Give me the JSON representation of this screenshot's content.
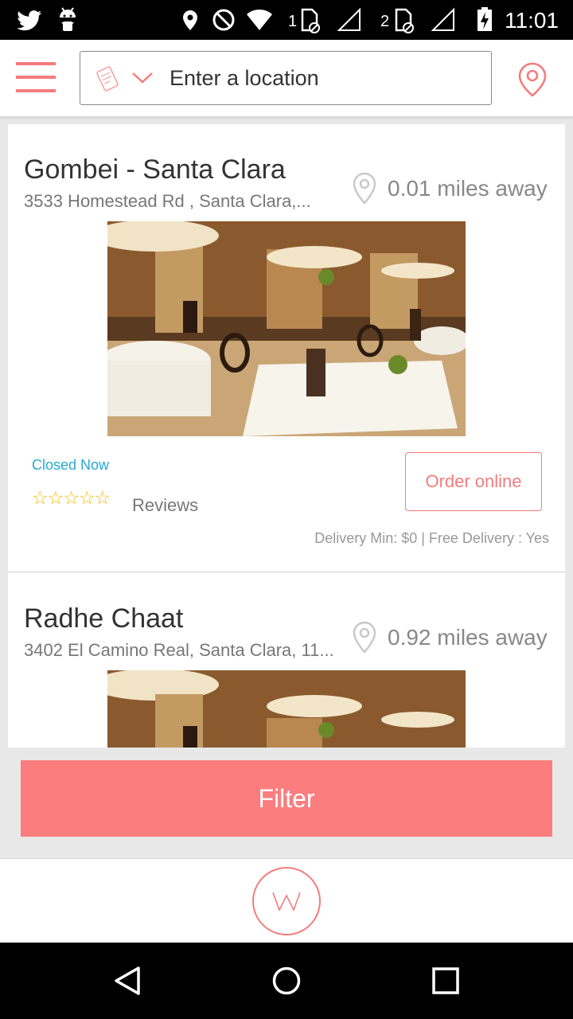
{
  "status_bar": {
    "time": "11:01",
    "sim1_label": "1",
    "sim2_label": "2",
    "icons": [
      "twitter-icon",
      "android-icon",
      "location-icon",
      "do-not-disturb-icon",
      "wifi-icon",
      "sim-icon",
      "signal-icon",
      "sim-icon",
      "signal-icon",
      "battery-charging-icon"
    ]
  },
  "header": {
    "search_placeholder": "Enter a location",
    "icons": [
      "menu-icon",
      "ticket-icon",
      "chevron-down-icon",
      "map-pin-icon"
    ]
  },
  "restaurants": [
    {
      "name": "Gombei - Santa Clara",
      "address": "3533 Homestead Rd   , Santa Clara,...",
      "distance": "0.01 miles away",
      "status": "Closed Now",
      "stars": "☆☆☆☆☆",
      "reviews_label": "Reviews",
      "order_label": "Order online",
      "delivery": "Delivery Min: $0 | Free Delivery : Yes"
    },
    {
      "name": "Radhe Chaat",
      "address": "3402 El Camino Real, Santa Clara, 11...",
      "distance": "0.92 miles away"
    }
  ],
  "filter_label": "Filter",
  "colors": {
    "accent": "#f47c7c",
    "filter_bg": "#fb7d7d",
    "status_closed": "#26a9d6",
    "stars": "#f5b800"
  }
}
